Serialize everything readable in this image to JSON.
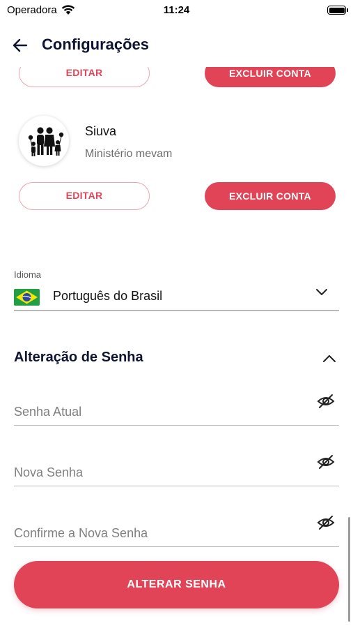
{
  "status_bar": {
    "carrier": "Operadora",
    "time": "11:24"
  },
  "header": {
    "title": "Configurações"
  },
  "accounts": [
    {
      "name": "",
      "subtitle": "",
      "edit_label": "EDITAR",
      "delete_label": "EXCLUIR CONTA"
    },
    {
      "name": "Siuva",
      "subtitle": "Ministério mevam",
      "edit_label": "EDITAR",
      "delete_label": "EXCLUIR CONTA"
    }
  ],
  "language": {
    "label": "Idioma",
    "value": "Português do Brasil"
  },
  "password_section": {
    "title": "Alteração de Senha",
    "fields": [
      {
        "placeholder": "Senha Atual"
      },
      {
        "placeholder": "Nova Senha"
      },
      {
        "placeholder": "Confirme a Nova Senha"
      }
    ],
    "submit_label": "ALTERAR SENHA"
  },
  "colors": {
    "accent": "#e04456",
    "accent_border": "#f1a3ae",
    "title": "#0f1531",
    "placeholder": "#808080",
    "divider": "#b9b9b9"
  },
  "icons": {
    "back": "arrow-left-icon",
    "wifi": "wifi-icon",
    "battery": "battery-icon",
    "language_toggle": "chevron-down-icon",
    "section_toggle": "chevron-up-icon",
    "password_visibility": "eye-off-icon",
    "flag": "brazil-flag-icon"
  }
}
